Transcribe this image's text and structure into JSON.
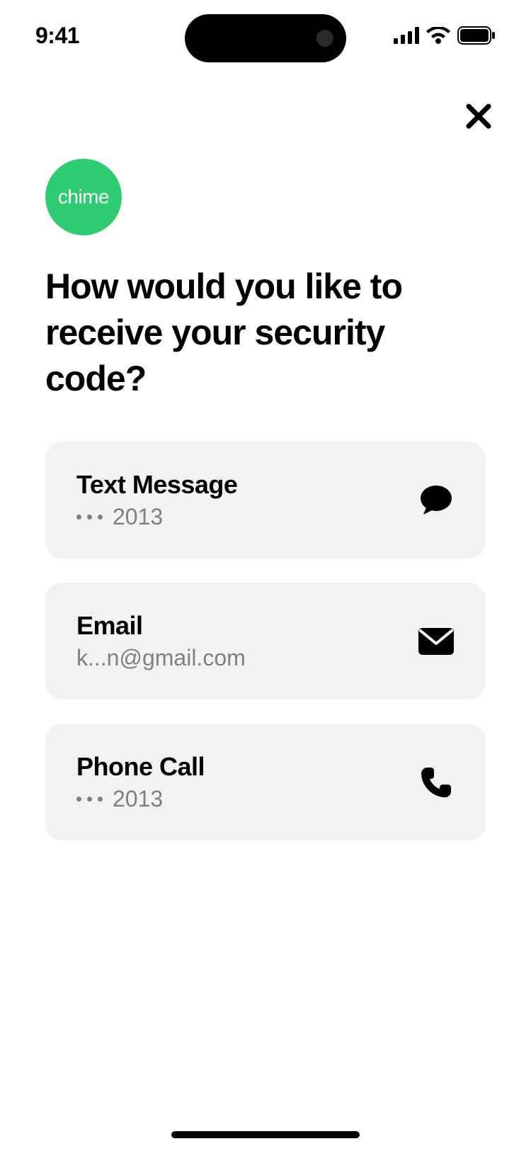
{
  "status": {
    "time": "9:41"
  },
  "brand": {
    "logoText": "chime"
  },
  "heading": "How would you like to receive your security code?",
  "options": [
    {
      "title": "Text Message",
      "masked": "2013",
      "showDots": true,
      "icon": "chat-bubble-icon"
    },
    {
      "title": "Email",
      "subtitle": "k...n@gmail.com",
      "showDots": false,
      "icon": "envelope-icon"
    },
    {
      "title": "Phone Call",
      "masked": "2013",
      "showDots": true,
      "icon": "phone-icon"
    }
  ]
}
